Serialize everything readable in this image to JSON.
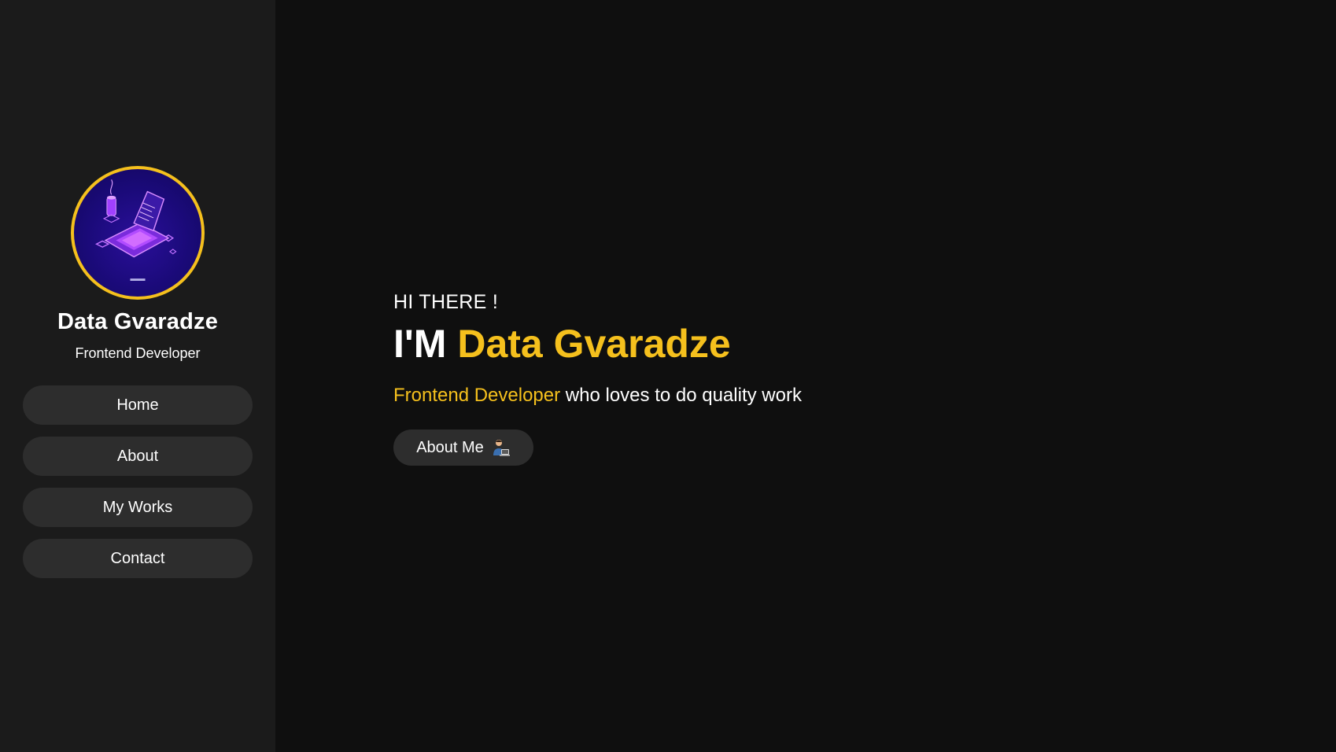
{
  "sidebar": {
    "profile": {
      "name": "Data Gvaradze",
      "role": "Frontend Developer"
    },
    "nav": [
      {
        "label": "Home"
      },
      {
        "label": "About"
      },
      {
        "label": "My Works"
      },
      {
        "label": "Contact"
      }
    ]
  },
  "hero": {
    "greeting": "HI THERE !",
    "headline_prefix": "I'M",
    "headline_name": "Data Gvaradze",
    "tagline_role": "Frontend Developer",
    "tagline_rest": "who loves to do quality work",
    "cta_label": "About Me",
    "cta_icon": "technologist-icon"
  },
  "colors": {
    "accent": "#f5c01d",
    "background": "#0f0f0f",
    "sidebar": "#1b1b1b",
    "button": "#2d2d2d"
  }
}
